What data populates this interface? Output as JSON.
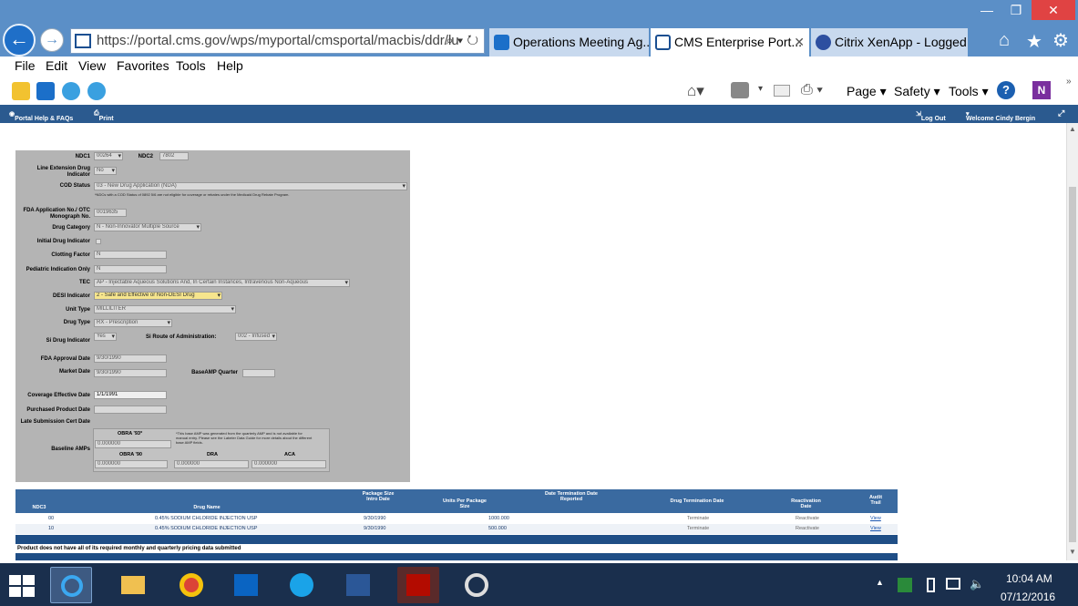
{
  "browser": {
    "url": "https://portal.cms.gov/wps/myportal/cmsportal/macbis/ddr/lu",
    "tabs": [
      {
        "label": "Operations Meeting Ag..."
      },
      {
        "label": "CMS Enterprise Port..."
      },
      {
        "label": "Citrix XenApp - Logged..."
      }
    ],
    "menu": [
      "File",
      "Edit",
      "View",
      "Favorites",
      "Tools",
      "Help"
    ],
    "command_bar": {
      "page": "Page",
      "safety": "Safety",
      "tools": "Tools"
    }
  },
  "portal_bar": {
    "help": "Portal Help & FAQs",
    "print": "Print",
    "logout": "Log Out",
    "welcome": "Welcome Cindy Bergin"
  },
  "form": {
    "ndc1": {
      "label": "NDC1",
      "value": "00264"
    },
    "ndc2": {
      "label": "NDC2",
      "value": "7802"
    },
    "line_ext": {
      "label": "Line Extension Drug Indicator",
      "value": "No"
    },
    "cod_status": {
      "label": "COD Status",
      "value": "03 - New Drug Application (NDA)",
      "note": "*NDCs with a COD Status of 0892 5/6 are not eligible for coverage or rebates under the Medicaid Drug Rebate Program."
    },
    "fda_app": {
      "label": "FDA Application No./ OTC Monograph No.",
      "value": "0019635"
    },
    "drug_cat": {
      "label": "Drug Category",
      "value": "N - Non-Innovator Multiple Source"
    },
    "initial_drug": {
      "label": "Initial Drug Indicator"
    },
    "clotting": {
      "label": "Clotting Factor",
      "value": "N"
    },
    "pediatric": {
      "label": "Pediatric Indication Only",
      "value": "N"
    },
    "tec": {
      "label": "TEC",
      "value": "AP - Injectable Aqueous Solutions And, In Certain Instances, Intravenous Non-Aqueous"
    },
    "desi": {
      "label": "DESI Indicator",
      "value": "2 - Safe and Effective or Non-DESI Drug"
    },
    "unit_type": {
      "label": "Unit Type",
      "value": "MILLILITER"
    },
    "drug_type": {
      "label": "Drug Type",
      "value": "RX - Prescription"
    },
    "si_drug": {
      "label": "Si Drug Indicator",
      "value": "Yes"
    },
    "si_route": {
      "label": "Si Route of Administration:",
      "value": "002 - Infused"
    },
    "fda_approval": {
      "label": "FDA Approval Date",
      "value": "9/30/1990"
    },
    "market_date": {
      "label": "Market Date",
      "value": "9/30/1990"
    },
    "base_amp_q": {
      "label": "BaseAMP Quarter"
    },
    "coverage": {
      "label": "Coverage Effective Date",
      "value": "1/1/1991"
    },
    "purchased": {
      "label": "Purchased Product Date"
    },
    "late_sub": {
      "label": "Late Submission Cert Date"
    },
    "baseline": {
      "label": "Baseline AMPs",
      "obra93": "OBRA '93*",
      "obra93_val": "0.000000",
      "note": "*This base AMP was generated from the quarterly AMP and is not available for manual entry. Please see the Labeler Data Guide for more details about the different base AMP fields.",
      "obra90": "OBRA '90",
      "obra90_val": "0.000000",
      "dra": "DRA",
      "dra_val": "0.000000",
      "aca": "ACA",
      "aca_val": "0.000000"
    }
  },
  "grid": {
    "headers": [
      "NDC3",
      "Drug Name",
      "Package Size Intro Date",
      "Units Per Package Size",
      "Date Termination Date Reported",
      "Drug Termination Date",
      "Reactivation Date",
      "Audit Trail"
    ],
    "rows": [
      {
        "ndc3": "00",
        "name": "0.45% SODIUM CHLORIDE INJECTION USP",
        "intro": "9/30/1990",
        "units": "1000.000",
        "term": "Terminate",
        "react": "Reactivate",
        "audit": "View"
      },
      {
        "ndc3": "10",
        "name": "0.45% SODIUM CHLORIDE INJECTION USP",
        "intro": "9/30/1990",
        "units": "500.000",
        "term": "Terminate",
        "react": "Reactivate",
        "audit": "View"
      }
    ],
    "footer": "Product does not have all of its required monthly and quarterly pricing data submitted"
  },
  "taskbar": {
    "time": "10:04 AM",
    "date": "07/12/2016"
  },
  "colors": {
    "chrome": "#5b8fc7",
    "portal_bar": "#2b5a8f",
    "form_bg": "#b4b4b4",
    "grid_head": "#3a6aa0",
    "desi_highlight": "#f6e58d",
    "taskbar": "#1a2f4d"
  }
}
